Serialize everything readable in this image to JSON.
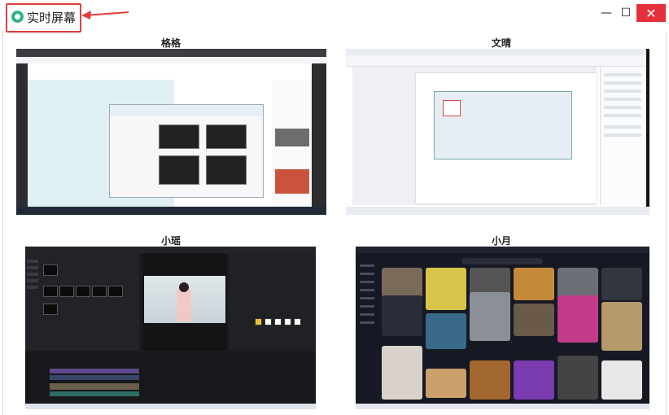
{
  "window": {
    "title": "实时屏幕",
    "minimize_glyph": "—",
    "maximize_glyph": "☐",
    "close_glyph": "✕"
  },
  "screens": [
    {
      "name": "格格",
      "content": "browser"
    },
    {
      "name": "文晴",
      "content": "document-editor"
    },
    {
      "name": "小瑶",
      "content": "video-editor"
    },
    {
      "name": "小月",
      "content": "short-video-feed"
    }
  ],
  "colors": {
    "highlight_border": "#e43c3c",
    "logo": "#2fb381",
    "close_button": "#e5303b"
  }
}
